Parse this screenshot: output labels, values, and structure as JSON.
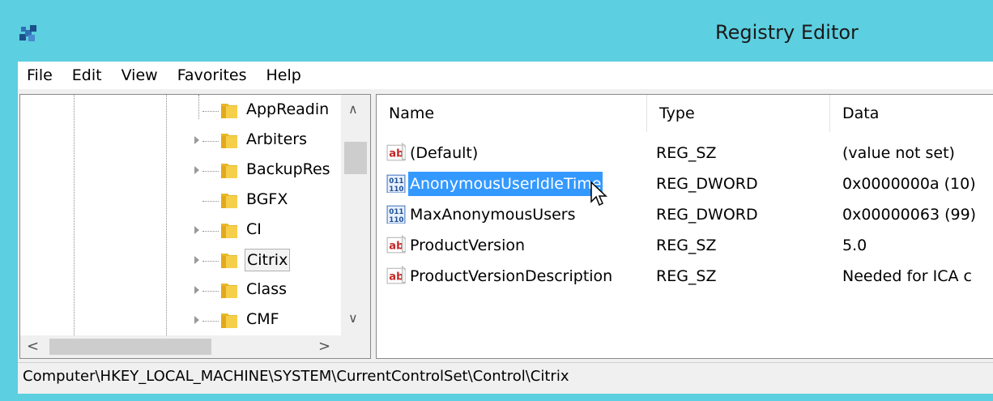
{
  "window": {
    "title": "Registry Editor",
    "app_icon": "registry-editor-icon",
    "accent_color": "#5ccfe0"
  },
  "menu": [
    "File",
    "Edit",
    "View",
    "Favorites",
    "Help"
  ],
  "tree": {
    "items": [
      {
        "label": "AppReadin",
        "expandable": false,
        "selected": false
      },
      {
        "label": "Arbiters",
        "expandable": true,
        "selected": false
      },
      {
        "label": "BackupRes",
        "expandable": true,
        "selected": false
      },
      {
        "label": "BGFX",
        "expandable": false,
        "selected": false
      },
      {
        "label": "CI",
        "expandable": true,
        "selected": false
      },
      {
        "label": "Citrix",
        "expandable": true,
        "selected": true
      },
      {
        "label": "Class",
        "expandable": true,
        "selected": false
      },
      {
        "label": "CMF",
        "expandable": true,
        "selected": false
      }
    ]
  },
  "values": {
    "columns": [
      "Name",
      "Type",
      "Data"
    ],
    "rows": [
      {
        "icon": "string-value-icon",
        "name": "(Default)",
        "type": "REG_SZ",
        "data": "(value not set)",
        "selected": false
      },
      {
        "icon": "dword-value-icon",
        "name": "AnonymousUserIdleTime",
        "type": "REG_DWORD",
        "data": "0x0000000a (10)",
        "selected": true
      },
      {
        "icon": "dword-value-icon",
        "name": "MaxAnonymousUsers",
        "type": "REG_DWORD",
        "data": "0x00000063 (99)",
        "selected": false
      },
      {
        "icon": "string-value-icon",
        "name": "ProductVersion",
        "type": "REG_SZ",
        "data": "5.0",
        "selected": false
      },
      {
        "icon": "string-value-icon",
        "name": "ProductVersionDescription",
        "type": "REG_SZ",
        "data": "Needed for ICA c",
        "selected": false
      }
    ]
  },
  "status": {
    "path": "Computer\\HKEY_LOCAL_MACHINE\\SYSTEM\\CurrentControlSet\\Control\\Citrix"
  }
}
